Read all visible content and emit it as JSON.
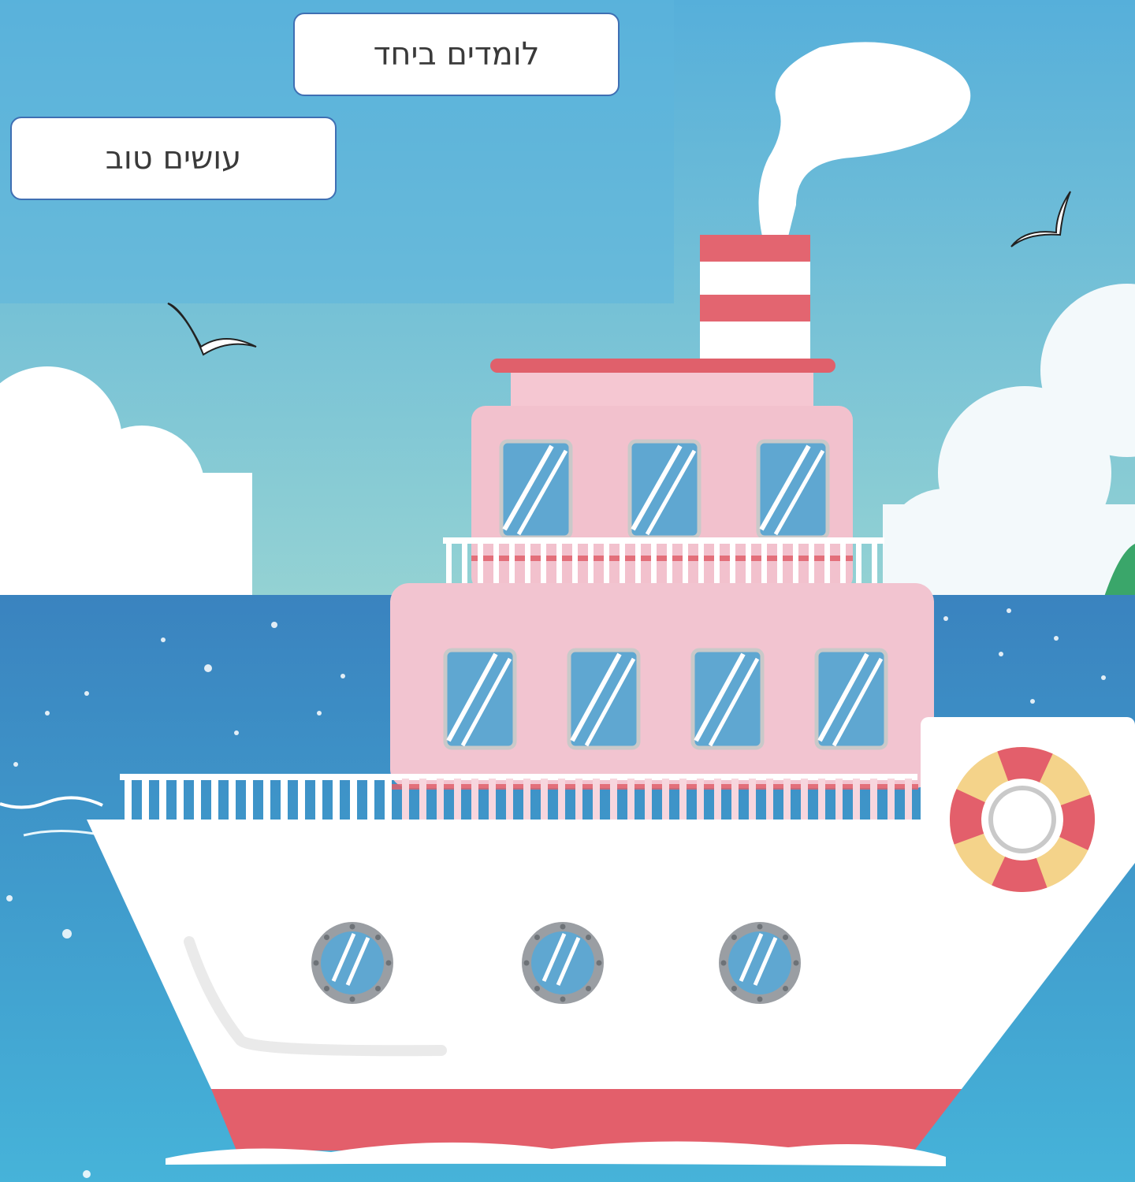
{
  "labels": {
    "learning_together": "לומדים ביחד",
    "doing_good": "עושים טוב"
  },
  "illustration": {
    "subject": "ship-illustration",
    "icons": [
      "ship-icon",
      "smoke-icon",
      "seagull-icon",
      "cloud-icon",
      "life-ring-icon",
      "porthole-icon",
      "window-icon",
      "island-icon"
    ]
  },
  "colors": {
    "sky_top": "#5bb4da",
    "sky_bottom": "#8fd0d6",
    "sea": "#3f8fc8",
    "hull": "#ffffff",
    "hull_stripe": "#e35f6b",
    "cabin": "#f2c3cf",
    "window": "#5fa7d1",
    "box_border": "#3f6fb3"
  }
}
